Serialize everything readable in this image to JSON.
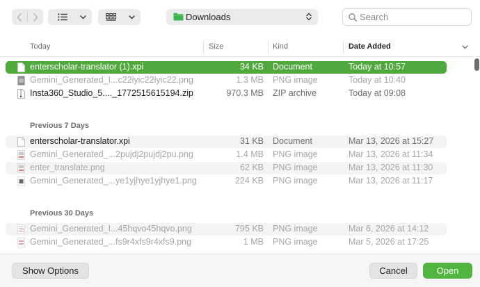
{
  "toolbar": {
    "back_icon": "chevron-left",
    "forward_icon": "chevron-right",
    "view_list_icon": "list-icon",
    "view_grid_icon": "grid-icon",
    "location": "Downloads",
    "search_placeholder": "Search"
  },
  "columns": {
    "name": "Today",
    "size": "Size",
    "kind": "Kind",
    "date": "Date Added"
  },
  "sections": {
    "prev7": "Previous 7 Days",
    "prev30": "Previous 30 Days"
  },
  "files": [
    {
      "name": "enterscholar-translator (1).xpi",
      "size": "34 KB",
      "kind": "Document",
      "date": "Today at 10:57"
    },
    {
      "name": "Gemini_Generated_I...c22lyic22lyic22.png",
      "size": "1.3 MB",
      "kind": "PNG image",
      "date": "Today at 10:40"
    },
    {
      "name": "Insta360_Studio_5...._1772515615194.zip",
      "size": "970.3 MB",
      "kind": "ZIP archive",
      "date": "Today at 09:08"
    },
    {
      "name": "enterscholar-translator.xpi",
      "size": "31 KB",
      "kind": "Document",
      "date": "Mar 13, 2026 at 15:27"
    },
    {
      "name": "Gemini_Generated_...2pujdj2pujdj2pu.png",
      "size": "1.4 MB",
      "kind": "PNG image",
      "date": "Mar 13, 2026 at 11:34"
    },
    {
      "name": "enter_translate.png",
      "size": "62 KB",
      "kind": "PNG image",
      "date": "Mar 13, 2026 at 11:30"
    },
    {
      "name": "Gemini_Generated_...ye1yjhye1yjhye1.png",
      "size": "224 KB",
      "kind": "PNG image",
      "date": "Mar 13, 2026 at 11:17"
    },
    {
      "name": "Gemini_Generated_I...45hqvo45hqvo.png",
      "size": "795 KB",
      "kind": "PNG image",
      "date": "Mar 6, 2026 at 14:12"
    },
    {
      "name": "Gemini_Generated_...fs9r4xfs9r4xfs9.png",
      "size": "1 MB",
      "kind": "PNG image",
      "date": "Mar 5, 2026 at 17:25"
    }
  ],
  "buttons": {
    "show_options": "Show Options",
    "cancel": "Cancel",
    "open": "Open"
  },
  "colors": {
    "accent": "#4fa93c",
    "open_button": "#4fb53f",
    "folder": "#3fb34f"
  }
}
